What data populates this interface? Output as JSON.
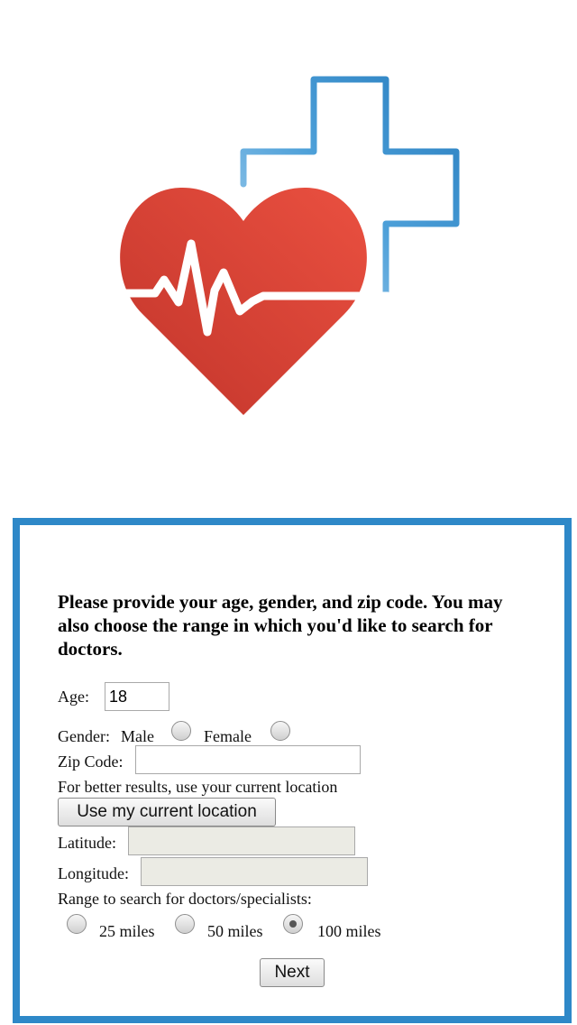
{
  "form": {
    "intro": "Please provide your age, gender, and zip code. You may also choose the range in which you'd like to search for doctors.",
    "age_label": "Age:",
    "age_value": "18",
    "gender_label": "Gender:",
    "gender_options": [
      "Male",
      "Female"
    ],
    "zip_label": "Zip Code:",
    "zip_value": "",
    "location_hint": "For better results, use your current location",
    "location_button": "Use my current location",
    "latitude_label": "Latitude:",
    "latitude_value": "",
    "longitude_label": "Longitude:",
    "longitude_value": "",
    "range_label": "Range to search for doctors/specialists:",
    "range_options": [
      "25 miles",
      "50 miles",
      "100 miles"
    ],
    "range_selected": "100 miles",
    "next_button": "Next"
  },
  "colors": {
    "accent": "#2e88c8",
    "heart": "#d9412f",
    "cross": "#2e88c8"
  },
  "logo": {
    "icon": "heart-pulse-cross-icon"
  }
}
